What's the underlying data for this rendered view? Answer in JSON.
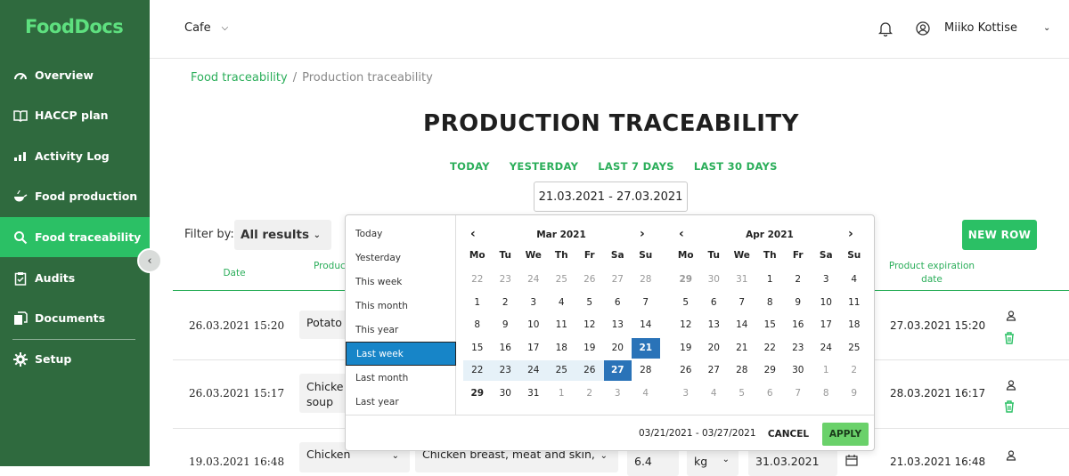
{
  "app": {
    "logo": "FoodDocs"
  },
  "sidebar": {
    "items": [
      {
        "label": "Overview",
        "icon": "gauge-icon"
      },
      {
        "label": "HACCP plan",
        "icon": "book-icon"
      },
      {
        "label": "Activity Log",
        "icon": "bar-chart-icon"
      },
      {
        "label": "Food production",
        "icon": "pan-icon"
      },
      {
        "label": "Food traceability",
        "icon": "search-icon",
        "active": true
      },
      {
        "label": "Audits",
        "icon": "clipboard-icon"
      },
      {
        "label": "Documents",
        "icon": "documents-icon"
      },
      {
        "label": "Setup",
        "icon": "gear-icon"
      }
    ]
  },
  "topbar": {
    "location": "Cafe",
    "user_name": "Miiko Kottise"
  },
  "breadcrumb": {
    "parent": "Food traceability",
    "separator": "/",
    "current": "Production traceability"
  },
  "page": {
    "title": "PRODUCTION TRACEABILITY",
    "quick_ranges": [
      "TODAY",
      "YESTERDAY",
      "LAST 7 DAYS",
      "LAST 30 DAYS"
    ],
    "date_range": "21.03.2021 - 27.03.2021",
    "filter_label": "Filter by:",
    "filter_value": "All results",
    "new_row_label": "NEW ROW"
  },
  "table": {
    "headers": {
      "date": "Date",
      "product": "Produc",
      "expiration_line1": "Product expiration",
      "expiration_line2": "date"
    },
    "rows": [
      {
        "date": "26.03.2021  15:20",
        "product": "Potato",
        "product2": "",
        "expiration": "27.03.2021 15:20"
      },
      {
        "date": "26.03.2021  15:17",
        "product": "Chicke",
        "product2": "soup",
        "expiration": "28.03.2021 16:17"
      },
      {
        "date": "19.03.2021  16:48",
        "product": "Chicken",
        "ingredient": "Chicken breast, meat and skin,",
        "quantity": "6.4",
        "unit": "kg",
        "ingredient_date": "31.03.2021",
        "expiration": "21.03.2021 16:48"
      }
    ]
  },
  "datepicker": {
    "ranges": [
      "Today",
      "Yesterday",
      "This week",
      "This month",
      "This year",
      "Last week",
      "Last month",
      "Last year"
    ],
    "active_range": "Last week",
    "weekdays": [
      "Mo",
      "Tu",
      "We",
      "Th",
      "Fr",
      "Sa",
      "Su"
    ],
    "left_month": "Mar 2021",
    "right_month": "Apr 2021",
    "left_days": [
      [
        "22",
        "23",
        "24",
        "25",
        "26",
        "27",
        "28"
      ],
      [
        "1",
        "2",
        "3",
        "4",
        "5",
        "6",
        "7"
      ],
      [
        "8",
        "9",
        "10",
        "11",
        "12",
        "13",
        "14"
      ],
      [
        "15",
        "16",
        "17",
        "18",
        "19",
        "20",
        "21"
      ],
      [
        "22",
        "23",
        "24",
        "25",
        "26",
        "27",
        "28"
      ],
      [
        "29",
        "30",
        "31",
        "1",
        "2",
        "3",
        "4"
      ]
    ],
    "right_days": [
      [
        "29",
        "30",
        "31",
        "1",
        "2",
        "3",
        "4"
      ],
      [
        "5",
        "6",
        "7",
        "8",
        "9",
        "10",
        "11"
      ],
      [
        "12",
        "13",
        "14",
        "15",
        "16",
        "17",
        "18"
      ],
      [
        "19",
        "20",
        "21",
        "22",
        "23",
        "24",
        "25"
      ],
      [
        "26",
        "27",
        "28",
        "29",
        "30",
        "1",
        "2"
      ],
      [
        "3",
        "4",
        "5",
        "6",
        "7",
        "8",
        "9"
      ]
    ],
    "footer_range": "03/21/2021 - 03/27/2021",
    "cancel_label": "CANCEL",
    "apply_label": "APPLY"
  },
  "colors": {
    "sidebar": "#2f6a3e",
    "accent": "#2bc065",
    "link": "#2bae5a",
    "selected_day": "#2a73b8"
  }
}
